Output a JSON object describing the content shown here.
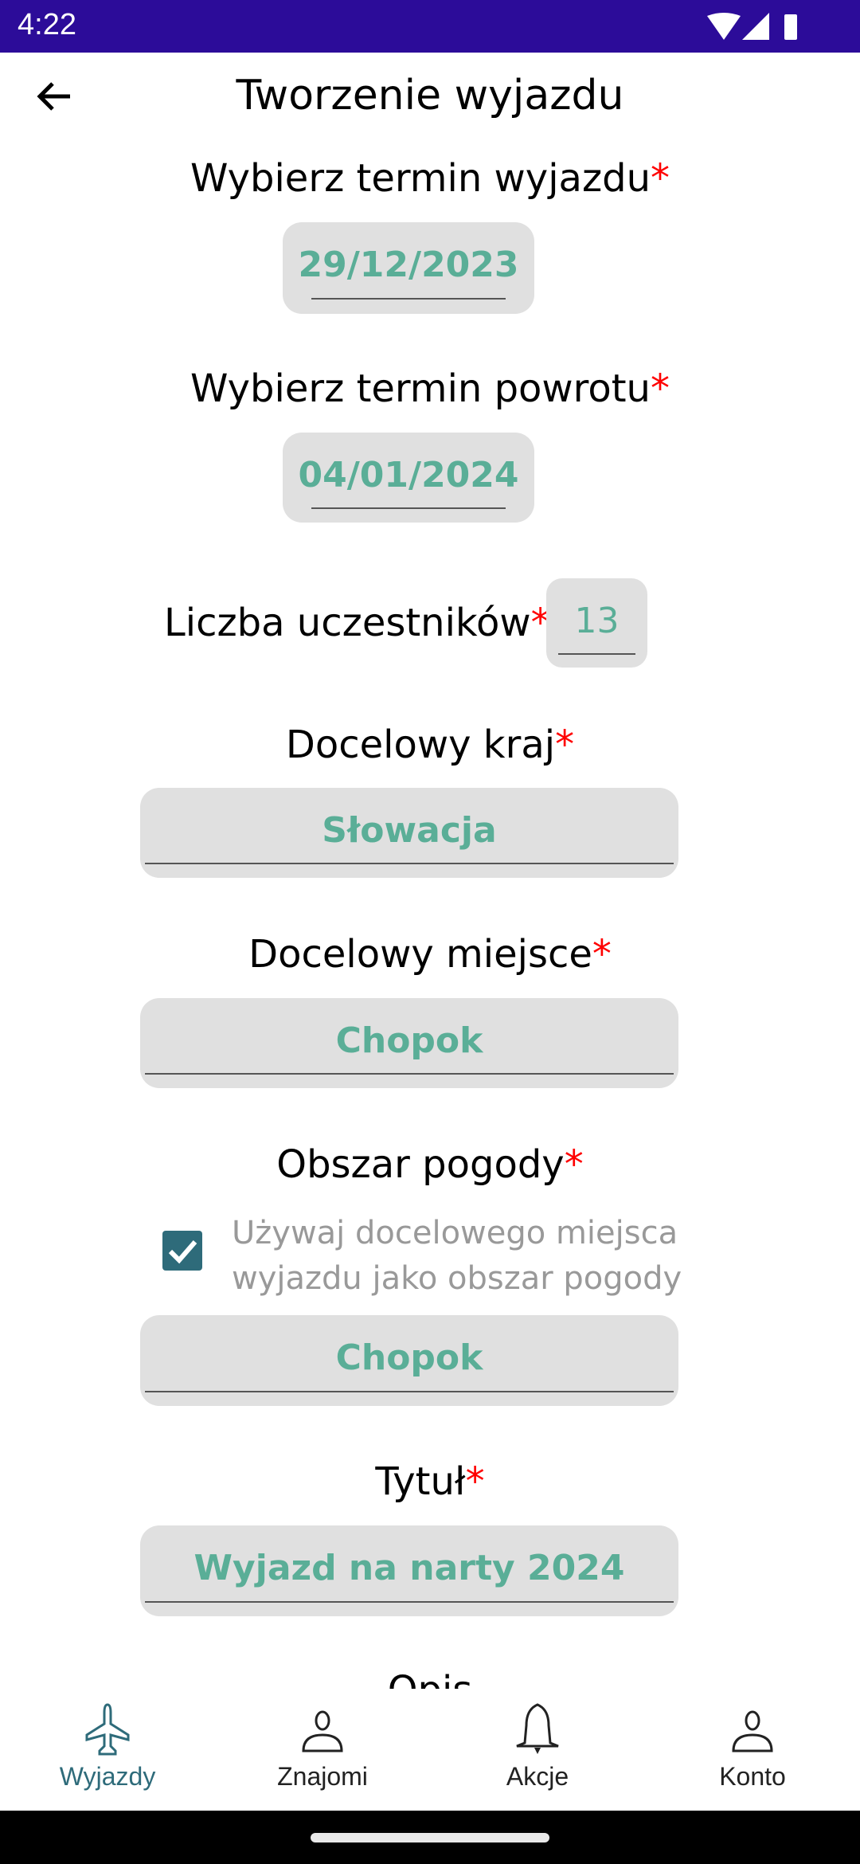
{
  "status_bar": {
    "time": "4:22"
  },
  "header": {
    "title": "Tworzenie wyjazdu"
  },
  "form": {
    "required_mark": "*",
    "departure": {
      "label": "Wybierz termin wyjazdu",
      "value": "29/12/2023"
    },
    "return": {
      "label": "Wybierz termin powrotu",
      "value": "04/01/2024"
    },
    "participants": {
      "label": "Liczba uczestników",
      "value": "13"
    },
    "country": {
      "label": "Docelowy kraj",
      "value": "Słowacja"
    },
    "place": {
      "label": "Docelowy miejsce",
      "value": "Chopok"
    },
    "weather": {
      "label": "Obszar pogody",
      "checkbox_line1": "Używaj docelowego miejsca",
      "checkbox_line2": "wyjazdu jako obszar pogody",
      "checked": true,
      "value": "Chopok"
    },
    "title": {
      "label": "Tytuł",
      "value": "Wyjazd na narty 2024"
    },
    "description": {
      "label": "Opis"
    }
  },
  "nav": {
    "items": [
      {
        "label": "Wyjazdy",
        "active": true
      },
      {
        "label": "Znajomi"
      },
      {
        "label": "Akcje"
      },
      {
        "label": "Konto"
      }
    ]
  },
  "colors": {
    "status_bar": "#2c0c99",
    "accent": "#2e6b7a",
    "input_text": "#5aae97"
  }
}
